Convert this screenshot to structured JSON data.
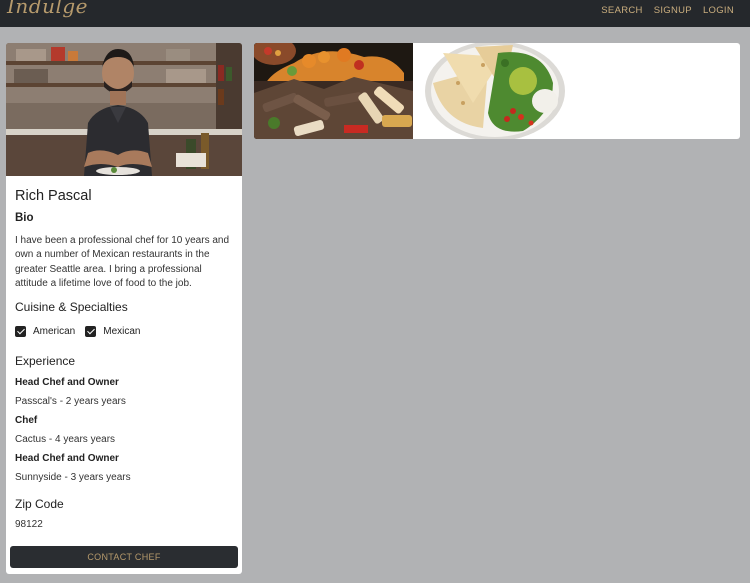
{
  "nav": {
    "brand": "Indulge",
    "links": [
      "SEARCH",
      "SIGNUP",
      "LOGIN"
    ]
  },
  "chef": {
    "name": "Rich Pascal",
    "bio_heading": "Bio",
    "bio": "I have been a professional chef for 10 years and own a number of Mexican restaurants in the greater Seattle area. I bring a professional attitude a lifetime love of food to the job.",
    "cuisine_heading": "Cuisine & Specialties",
    "cuisines": [
      {
        "label": "American",
        "checked": true
      },
      {
        "label": "Mexican",
        "checked": true
      }
    ],
    "experience_heading": "Experience",
    "experience": [
      {
        "title": "Head Chef and Owner",
        "detail": "Passcal's - 2 years years"
      },
      {
        "title": "Chef",
        "detail": "Cactus - 4 years years"
      },
      {
        "title": "Head Chef and Owner",
        "detail": "Sunnyside - 3 years years"
      }
    ],
    "zip_heading": "Zip Code",
    "zip": "98122",
    "contact_label": "CONTACT CHEF"
  },
  "colors": {
    "navbar": "#25282c",
    "accent": "#b69a6c",
    "page_bg": "#b1b2b4",
    "button": "#2a2d31"
  }
}
